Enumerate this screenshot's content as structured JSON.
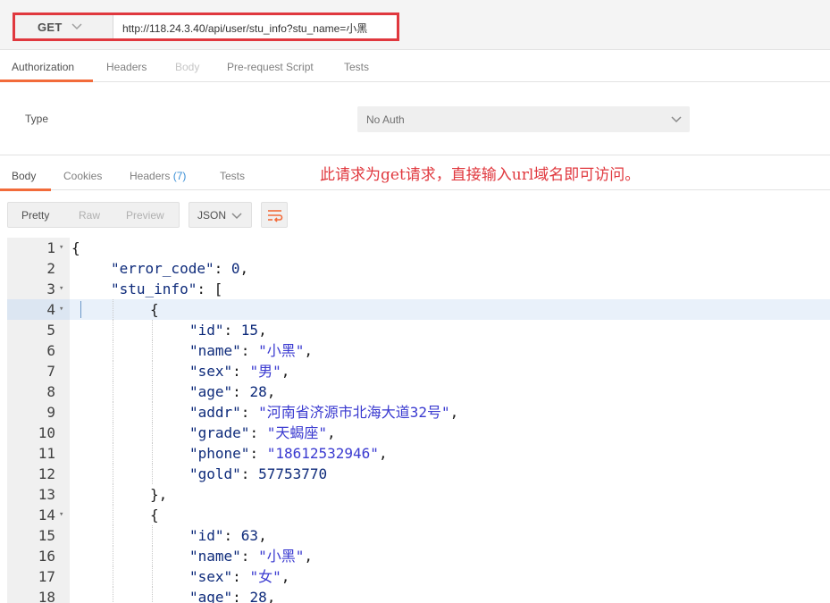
{
  "request": {
    "method": "GET",
    "url": "http://118.24.3.40/api/user/stu_info?stu_name=小黑"
  },
  "request_tabs": [
    {
      "label": "Authorization",
      "state": "active"
    },
    {
      "label": "Headers",
      "state": "normal"
    },
    {
      "label": "Body",
      "state": "disabled"
    },
    {
      "label": "Pre-request Script",
      "state": "normal"
    },
    {
      "label": "Tests",
      "state": "normal"
    }
  ],
  "auth": {
    "type_label": "Type",
    "type_value": "No Auth"
  },
  "response_tabs": [
    {
      "label": "Body",
      "state": "active"
    },
    {
      "label": "Cookies",
      "state": "normal"
    },
    {
      "label": "Headers",
      "badge": "(7)",
      "state": "normal"
    },
    {
      "label": "Tests",
      "state": "normal"
    }
  ],
  "annotation": "此请求为get请求，直接输入url域名即可访问。",
  "body_toolbar": {
    "formats": [
      "Pretty",
      "Raw",
      "Preview"
    ],
    "selected_format": "Pretty",
    "language": "JSON",
    "wrap_icon": "wrap-lines-icon"
  },
  "code": {
    "active_line": 4,
    "lines": [
      {
        "n": "1",
        "fold": true,
        "indent": 0,
        "tokens": [
          [
            "p",
            "{"
          ]
        ]
      },
      {
        "n": "2",
        "fold": false,
        "indent": 1,
        "tokens": [
          [
            "k",
            "\"error_code\""
          ],
          [
            "p",
            ": "
          ],
          [
            "n",
            "0"
          ],
          [
            "p",
            ","
          ]
        ]
      },
      {
        "n": "3",
        "fold": true,
        "indent": 1,
        "tokens": [
          [
            "k",
            "\"stu_info\""
          ],
          [
            "p",
            ": ["
          ]
        ]
      },
      {
        "n": "4",
        "fold": true,
        "indent": 2,
        "tokens": [
          [
            "p",
            "{"
          ]
        ]
      },
      {
        "n": "5",
        "fold": false,
        "indent": 3,
        "tokens": [
          [
            "k",
            "\"id\""
          ],
          [
            "p",
            ": "
          ],
          [
            "n",
            "15"
          ],
          [
            "p",
            ","
          ]
        ]
      },
      {
        "n": "6",
        "fold": false,
        "indent": 3,
        "tokens": [
          [
            "k",
            "\"name\""
          ],
          [
            "p",
            ": "
          ],
          [
            "s",
            "\"小黑\""
          ],
          [
            "p",
            ","
          ]
        ]
      },
      {
        "n": "7",
        "fold": false,
        "indent": 3,
        "tokens": [
          [
            "k",
            "\"sex\""
          ],
          [
            "p",
            ": "
          ],
          [
            "s",
            "\"男\""
          ],
          [
            "p",
            ","
          ]
        ]
      },
      {
        "n": "8",
        "fold": false,
        "indent": 3,
        "tokens": [
          [
            "k",
            "\"age\""
          ],
          [
            "p",
            ": "
          ],
          [
            "n",
            "28"
          ],
          [
            "p",
            ","
          ]
        ]
      },
      {
        "n": "9",
        "fold": false,
        "indent": 3,
        "tokens": [
          [
            "k",
            "\"addr\""
          ],
          [
            "p",
            ": "
          ],
          [
            "s",
            "\"河南省济源市北海大道32号\""
          ],
          [
            "p",
            ","
          ]
        ]
      },
      {
        "n": "10",
        "fold": false,
        "indent": 3,
        "tokens": [
          [
            "k",
            "\"grade\""
          ],
          [
            "p",
            ": "
          ],
          [
            "s",
            "\"天蝎座\""
          ],
          [
            "p",
            ","
          ]
        ]
      },
      {
        "n": "11",
        "fold": false,
        "indent": 3,
        "tokens": [
          [
            "k",
            "\"phone\""
          ],
          [
            "p",
            ": "
          ],
          [
            "s",
            "\"18612532946\""
          ],
          [
            "p",
            ","
          ]
        ]
      },
      {
        "n": "12",
        "fold": false,
        "indent": 3,
        "tokens": [
          [
            "k",
            "\"gold\""
          ],
          [
            "p",
            ": "
          ],
          [
            "n",
            "57753770"
          ]
        ]
      },
      {
        "n": "13",
        "fold": false,
        "indent": 2,
        "tokens": [
          [
            "p",
            "},"
          ]
        ]
      },
      {
        "n": "14",
        "fold": true,
        "indent": 2,
        "tokens": [
          [
            "p",
            "{"
          ]
        ]
      },
      {
        "n": "15",
        "fold": false,
        "indent": 3,
        "tokens": [
          [
            "k",
            "\"id\""
          ],
          [
            "p",
            ": "
          ],
          [
            "n",
            "63"
          ],
          [
            "p",
            ","
          ]
        ]
      },
      {
        "n": "16",
        "fold": false,
        "indent": 3,
        "tokens": [
          [
            "k",
            "\"name\""
          ],
          [
            "p",
            ": "
          ],
          [
            "s",
            "\"小黑\""
          ],
          [
            "p",
            ","
          ]
        ]
      },
      {
        "n": "17",
        "fold": false,
        "indent": 3,
        "tokens": [
          [
            "k",
            "\"sex\""
          ],
          [
            "p",
            ": "
          ],
          [
            "s",
            "\"女\""
          ],
          [
            "p",
            ","
          ]
        ]
      },
      {
        "n": "18",
        "fold": false,
        "indent": 3,
        "tokens": [
          [
            "k",
            "\"age\""
          ],
          [
            "p",
            ": "
          ],
          [
            "n",
            "28"
          ],
          [
            "p",
            ","
          ]
        ]
      }
    ]
  },
  "colors": {
    "accent": "#f26b3a",
    "highlight_box": "#e0383e",
    "annotation": "#e0383e",
    "json_key": "#0d2a7a",
    "json_string": "#3a3ad0",
    "active_line": "#e9f1fa"
  }
}
